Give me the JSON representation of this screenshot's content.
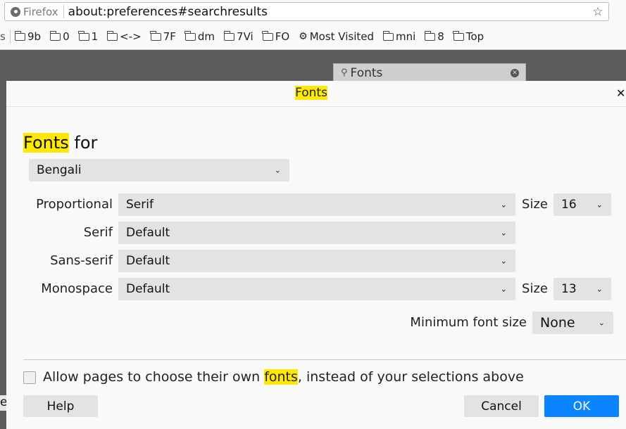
{
  "browser": {
    "identity_label": "Firefox",
    "url": "about:preferences#searchresults",
    "bookmark_lead": "s",
    "bookmarks": [
      {
        "label": "9b",
        "icon": "folder-icon"
      },
      {
        "label": "0",
        "icon": "folder-icon"
      },
      {
        "label": "1",
        "icon": "folder-icon"
      },
      {
        "label": "<->",
        "icon": "folder-icon"
      },
      {
        "label": "7F",
        "icon": "folder-icon"
      },
      {
        "label": "dm",
        "icon": "folder-icon"
      },
      {
        "label": "7Vi",
        "icon": "folder-icon"
      },
      {
        "label": "FO",
        "icon": "folder-icon"
      },
      {
        "label": "Most Visited",
        "icon": "gear-icon"
      },
      {
        "label": "mni",
        "icon": "folder-icon"
      },
      {
        "label": "8",
        "icon": "folder-icon"
      },
      {
        "label": "Top",
        "icon": "folder-icon"
      }
    ]
  },
  "background": {
    "search_value": "Fonts",
    "edge_text": "e"
  },
  "dialog": {
    "title": "Fonts",
    "section_heading_highlight": "Fonts",
    "section_heading_rest": " for",
    "language_select": "Bengali",
    "rows": {
      "proportional": {
        "label": "Proportional",
        "value": "Serif",
        "size_label": "Size",
        "size_value": "16"
      },
      "serif": {
        "label": "Serif",
        "value": "Default"
      },
      "sans_serif": {
        "label": "Sans-serif",
        "value": "Default"
      },
      "monospace": {
        "label": "Monospace",
        "value": "Default",
        "size_label": "Size",
        "size_value": "13"
      }
    },
    "min_font_label": "Minimum font size",
    "min_font_value": "None",
    "allow_pages": {
      "prefix": "Allow pages to choose their own ",
      "highlight": "fonts",
      "suffix": ", instead of your selections above",
      "checked": false
    },
    "buttons": {
      "help": "Help",
      "cancel": "Cancel",
      "ok": "OK"
    }
  },
  "colors": {
    "highlight": "#ffe900",
    "primary_button": "#0a84ff"
  }
}
